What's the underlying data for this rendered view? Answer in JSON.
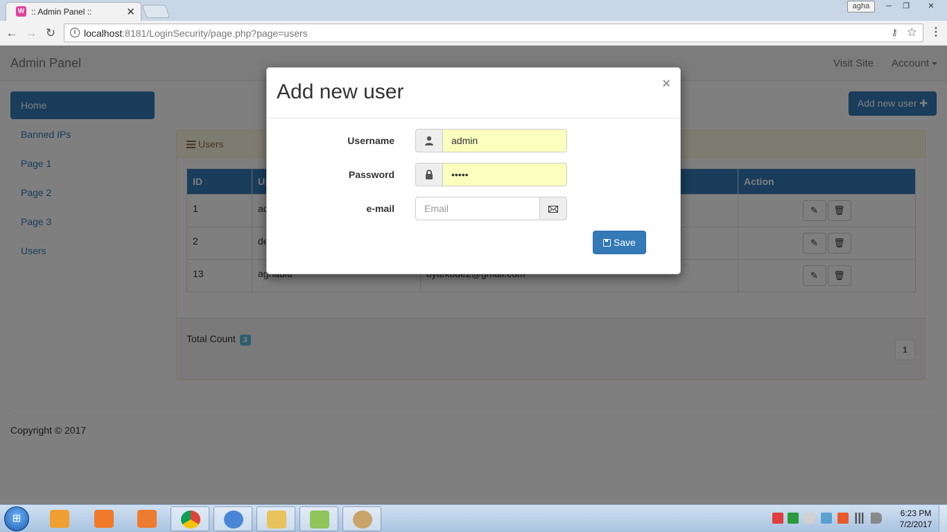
{
  "browser": {
    "tab_title": ":: Admin Panel ::",
    "tab_icon": "wamp-icon",
    "url_host": "localhost",
    "url_rest": ":8181/LoginSecurity/page.php?page=users",
    "profile_name": "agha",
    "win_min": "─",
    "win_max": "❐",
    "win_close": "✕"
  },
  "navbar": {
    "brand": "Admin Panel",
    "links": [
      "Visit Site",
      "Account"
    ]
  },
  "sidebar": {
    "items": [
      {
        "label": "Home",
        "active": true
      },
      {
        "label": "Banned IPs"
      },
      {
        "label": "Page 1"
      },
      {
        "label": "Page 2"
      },
      {
        "label": "Page 3"
      },
      {
        "label": "Users"
      }
    ]
  },
  "main": {
    "add_user_label": "Add new user",
    "add_user_plus": "✚",
    "panel_title": "Users",
    "table": {
      "headers": [
        "ID",
        "Us",
        "",
        "Action"
      ],
      "rows": [
        {
          "id": "1",
          "user": "ad",
          "email": ""
        },
        {
          "id": "2",
          "user": "de",
          "email": ""
        },
        {
          "id": "13",
          "user": "aghadiu",
          "email": "bytekode2@gmail.com"
        }
      ]
    },
    "total_count_label": "Total Count",
    "total_count": "3",
    "pager": [
      "1"
    ]
  },
  "footer": {
    "copyright": "Copyright © 2017"
  },
  "modal": {
    "title": "Add new user",
    "close": "×",
    "username_label": "Username",
    "username_value": "admin",
    "password_label": "Password",
    "password_value": "•••••",
    "email_label": "e-mail",
    "email_placeholder": "Email",
    "save_label": "Save"
  },
  "taskbar": {
    "apps": [
      "windows-media-player",
      "screenshot-tool",
      "camera-tool",
      "chrome",
      "chrome-profile",
      "file-explorer",
      "notepad-plus",
      "paint"
    ],
    "time": "6:23 PM",
    "date": "7/2/2017"
  },
  "colors": {
    "primary": "#337ab7",
    "warning_panel": "#fcf8e3",
    "autofill": "#faffbd",
    "info_badge": "#5bc0de"
  }
}
